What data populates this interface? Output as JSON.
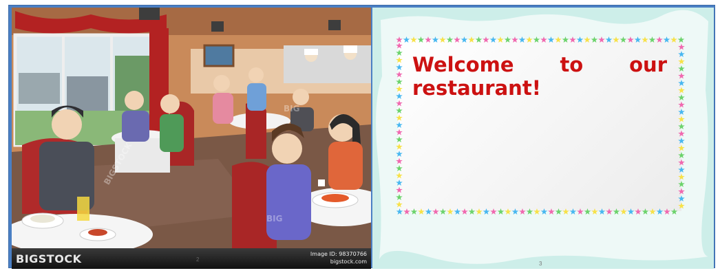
{
  "book": {
    "left_page": {
      "image_alt": "Illustration of people dining in a restaurant",
      "watermark_brand": "BIGSTOCK",
      "watermark_image_id": "Image ID: 98370766",
      "watermark_site": "bigstock.com",
      "page_number": "2",
      "overlay_watermarks": [
        "BIG",
        "BIGSTOCK",
        "BIG"
      ]
    },
    "right_page": {
      "welcome_text": "Welcome to our restaurant!",
      "page_number": "3"
    }
  },
  "colors": {
    "book_border": "#4a7fc4",
    "page_bg": "#e7f7f5",
    "welcome_text": "#cc1111"
  }
}
